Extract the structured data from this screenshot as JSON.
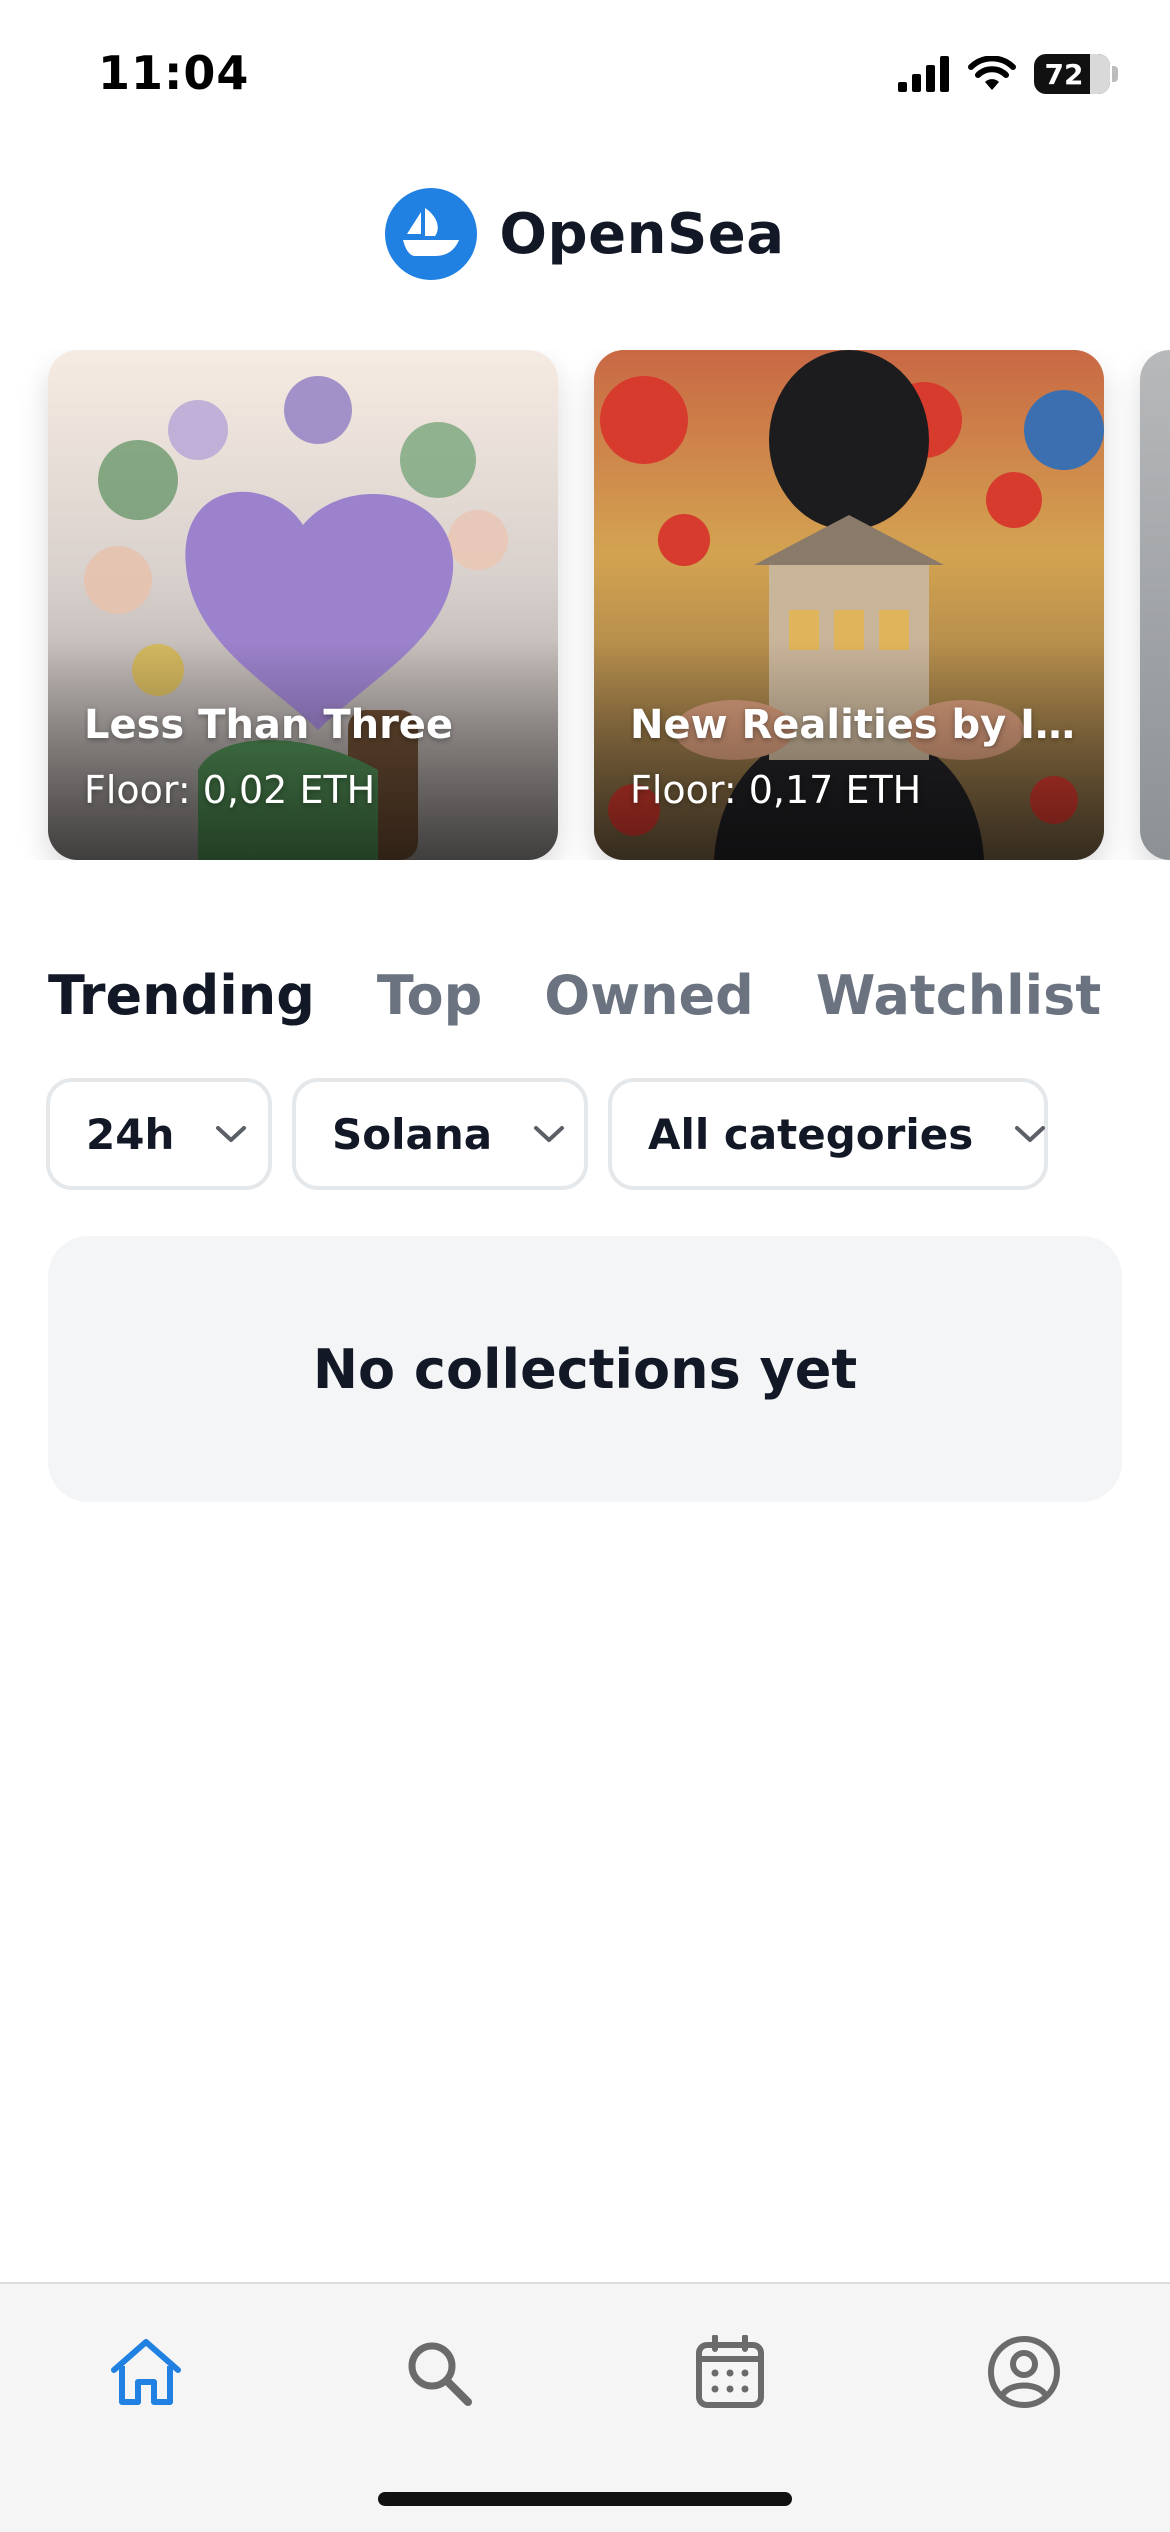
{
  "status_bar": {
    "time": "11:04",
    "battery": "72",
    "icons": [
      "signal-icon",
      "wifi-icon",
      "battery-icon"
    ]
  },
  "header": {
    "logo_icon": "opensea-logo-icon",
    "title": "OpenSea"
  },
  "featured": [
    {
      "name": "Less Than Three",
      "floor": "Floor: 0,02 ETH"
    },
    {
      "name": "New Realities by In...",
      "floor": "Floor: 0,17 ETH"
    }
  ],
  "tabs": [
    {
      "label": "Trending",
      "active": true
    },
    {
      "label": "Top",
      "active": false
    },
    {
      "label": "Owned",
      "active": false
    },
    {
      "label": "Watchlist",
      "active": false
    }
  ],
  "filters": {
    "period": "24h",
    "chain": "Solana",
    "category": "All categories"
  },
  "empty_state": {
    "message": "No collections yet"
  },
  "bottom_nav": {
    "items": [
      "home-icon",
      "search-icon",
      "calendar-icon",
      "profile-icon"
    ],
    "active": "home-icon"
  },
  "colors": {
    "accent": "#2081e2",
    "text": "#121826",
    "muted": "#6b7280",
    "inactive_icon": "#6b6b6b"
  }
}
